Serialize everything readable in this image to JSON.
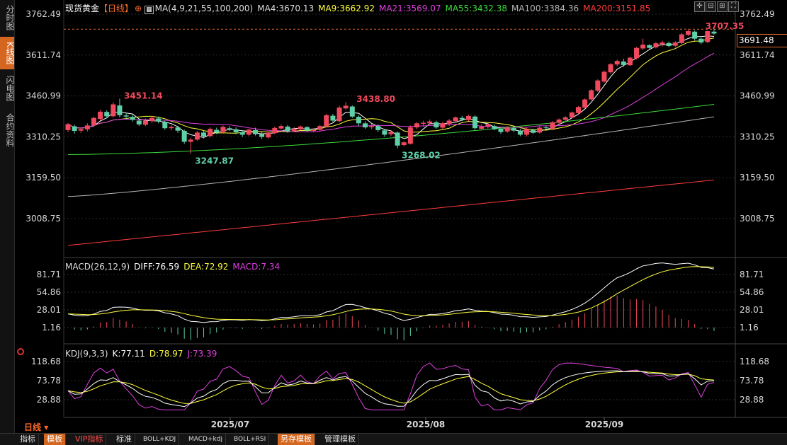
{
  "sidebar": {
    "tabs": [
      {
        "label": "分时图",
        "active": false
      },
      {
        "label": "K线图",
        "active": true
      },
      {
        "label": "闪电图",
        "active": false
      },
      {
        "label": "合约资料",
        "active": false
      }
    ]
  },
  "header": {
    "symbol": "现货黄金",
    "period_tag": "【日线】",
    "ma_params": "MA(4,9,21,55,100,200)",
    "ma4": "MA4:3670.13",
    "ma9": "MA9:3662.92",
    "ma21": "MA21:3569.07",
    "ma55": "MA55:3432.38",
    "ma100": "MA100:3384.36",
    "ma200": "MA200:3151.85"
  },
  "price_axis": {
    "labels": [
      "3762.49",
      "3611.74",
      "3460.99",
      "3310.25",
      "3159.50",
      "3008.75"
    ],
    "current_price": "3691.48"
  },
  "annotations": {
    "high1": "3451.14",
    "high2": "3438.80",
    "low1": "3247.87",
    "low2": "3268.02",
    "high_recent": "3707.35"
  },
  "macd": {
    "title": "MACD(26,12,9)",
    "diff": "DIFF:76.59",
    "dea": "DEA:72.92",
    "macd": "MACD:7.34",
    "axis_labels": [
      "81.71",
      "54.86",
      "28.01",
      "1.16"
    ]
  },
  "kdj": {
    "title": "KDJ(9,3,3)",
    "k": "K:77.11",
    "d": "D:78.97",
    "j": "J:73.39",
    "axis_labels": [
      "118.68",
      "73.78",
      "28.88"
    ]
  },
  "x_axis": {
    "labels": [
      "2025/07",
      "2025/08",
      "2025/09"
    ]
  },
  "period_label": "日线",
  "bottom_bar": {
    "buttons": [
      {
        "label": "指标",
        "style": "normal"
      },
      {
        "label": "模板",
        "style": "orange"
      },
      {
        "label": "VIP指标",
        "style": "red"
      },
      {
        "label": "标准",
        "style": "normal"
      },
      {
        "label": "BOLL+KDJ",
        "style": "small"
      },
      {
        "label": "MACD+kdj",
        "style": "small"
      },
      {
        "label": "BOLL+RSI",
        "style": "small"
      },
      {
        "label": "另存模板",
        "style": "orange"
      },
      {
        "label": "管理模板",
        "style": "normal"
      }
    ]
  },
  "colors": {
    "up": "#f0495d",
    "down": "#5ed0a8",
    "ma4": "#ffffff",
    "ma9": "#ffff3c",
    "ma21": "#e040e0",
    "ma55": "#3cdc3c",
    "ma100": "#b4b4b4",
    "ma200": "#ff3c3c",
    "accent": "#d4661f"
  },
  "chart_data": {
    "type": "candlestick",
    "price_axis_ticks": [
      3762.49,
      3611.74,
      3460.99,
      3310.25,
      3159.5,
      3008.75
    ],
    "candles": [
      [
        3335,
        3357,
        3328,
        3361
      ],
      [
        3349,
        3332,
        3322,
        3355
      ],
      [
        3333,
        3339,
        3324,
        3346
      ],
      [
        3338,
        3352,
        3330,
        3360
      ],
      [
        3352,
        3380,
        3347,
        3384
      ],
      [
        3376,
        3403,
        3370,
        3410
      ],
      [
        3402,
        3386,
        3378,
        3408
      ],
      [
        3386,
        3430,
        3382,
        3438
      ],
      [
        3426,
        3390,
        3382,
        3451
      ],
      [
        3389,
        3385,
        3375,
        3398
      ],
      [
        3384,
        3373,
        3366,
        3392
      ],
      [
        3370,
        3356,
        3350,
        3378
      ],
      [
        3355,
        3370,
        3350,
        3378
      ],
      [
        3368,
        3380,
        3362,
        3387
      ],
      [
        3378,
        3367,
        3360,
        3385
      ],
      [
        3365,
        3342,
        3336,
        3370
      ],
      [
        3342,
        3347,
        3334,
        3353
      ],
      [
        3345,
        3333,
        3325,
        3351
      ],
      [
        3332,
        3292,
        3284,
        3337
      ],
      [
        3292,
        3300,
        3248,
        3307
      ],
      [
        3300,
        3326,
        3296,
        3332
      ],
      [
        3326,
        3312,
        3304,
        3334
      ],
      [
        3313,
        3340,
        3308,
        3345
      ],
      [
        3336,
        3327,
        3320,
        3344
      ],
      [
        3328,
        3347,
        3322,
        3352
      ],
      [
        3342,
        3340,
        3332,
        3350
      ],
      [
        3338,
        3327,
        3320,
        3345
      ],
      [
        3327,
        3318,
        3310,
        3335
      ],
      [
        3318,
        3337,
        3313,
        3340
      ],
      [
        3335,
        3320,
        3315,
        3344
      ],
      [
        3320,
        3310,
        3302,
        3328
      ],
      [
        3308,
        3325,
        3304,
        3330
      ],
      [
        3324,
        3343,
        3320,
        3348
      ],
      [
        3341,
        3350,
        3337,
        3355
      ],
      [
        3348,
        3330,
        3325,
        3354
      ],
      [
        3332,
        3340,
        3328,
        3346
      ],
      [
        3338,
        3348,
        3334,
        3352
      ],
      [
        3346,
        3333,
        3328,
        3350
      ],
      [
        3332,
        3336,
        3328,
        3342
      ],
      [
        3336,
        3350,
        3330,
        3355
      ],
      [
        3348,
        3390,
        3345,
        3395
      ],
      [
        3388,
        3370,
        3365,
        3395
      ],
      [
        3368,
        3418,
        3364,
        3425
      ],
      [
        3415,
        3425,
        3410,
        3439
      ],
      [
        3422,
        3385,
        3380,
        3426
      ],
      [
        3384,
        3360,
        3350,
        3390
      ],
      [
        3360,
        3345,
        3340,
        3368
      ],
      [
        3346,
        3350,
        3338,
        3358
      ],
      [
        3350,
        3335,
        3328,
        3356
      ],
      [
        3334,
        3318,
        3310,
        3340
      ],
      [
        3320,
        3328,
        3314,
        3335
      ],
      [
        3326,
        3278,
        3268,
        3330
      ],
      [
        3280,
        3290,
        3275,
        3295
      ],
      [
        3285,
        3345,
        3282,
        3352
      ],
      [
        3345,
        3360,
        3338,
        3365
      ],
      [
        3358,
        3362,
        3348,
        3370
      ],
      [
        3360,
        3367,
        3355,
        3374
      ],
      [
        3364,
        3345,
        3340,
        3370
      ],
      [
        3344,
        3360,
        3338,
        3366
      ],
      [
        3358,
        3370,
        3350,
        3376
      ],
      [
        3368,
        3382,
        3362,
        3385
      ],
      [
        3380,
        3374,
        3368,
        3388
      ],
      [
        3372,
        3387,
        3368,
        3392
      ],
      [
        3385,
        3342,
        3336,
        3390
      ],
      [
        3340,
        3348,
        3334,
        3356
      ],
      [
        3348,
        3357,
        3341,
        3360
      ],
      [
        3350,
        3338,
        3334,
        3356
      ],
      [
        3340,
        3328,
        3320,
        3346
      ],
      [
        3330,
        3345,
        3325,
        3350
      ],
      [
        3343,
        3333,
        3328,
        3350
      ],
      [
        3332,
        3318,
        3313,
        3340
      ],
      [
        3318,
        3338,
        3312,
        3345
      ],
      [
        3336,
        3325,
        3320,
        3340
      ],
      [
        3326,
        3344,
        3322,
        3350
      ],
      [
        3345,
        3343,
        3338,
        3352
      ],
      [
        3340,
        3364,
        3336,
        3368
      ],
      [
        3362,
        3374,
        3356,
        3378
      ],
      [
        3373,
        3382,
        3369,
        3386
      ],
      [
        3381,
        3400,
        3378,
        3404
      ],
      [
        3398,
        3420,
        3394,
        3424
      ],
      [
        3418,
        3448,
        3415,
        3452
      ],
      [
        3448,
        3482,
        3444,
        3486
      ],
      [
        3480,
        3518,
        3476,
        3522
      ],
      [
        3514,
        3550,
        3510,
        3555
      ],
      [
        3548,
        3578,
        3542,
        3582
      ],
      [
        3577,
        3590,
        3570,
        3595
      ],
      [
        3588,
        3575,
        3568,
        3598
      ],
      [
        3574,
        3602,
        3572,
        3606
      ],
      [
        3600,
        3638,
        3596,
        3642
      ],
      [
        3636,
        3650,
        3630,
        3672
      ],
      [
        3648,
        3638,
        3632,
        3652
      ],
      [
        3640,
        3655,
        3636,
        3660
      ],
      [
        3652,
        3658,
        3643,
        3665
      ],
      [
        3656,
        3645,
        3640,
        3662
      ],
      [
        3646,
        3658,
        3640,
        3663
      ],
      [
        3656,
        3688,
        3653,
        3694
      ],
      [
        3686,
        3700,
        3682,
        3707
      ],
      [
        3698,
        3672,
        3665,
        3702
      ],
      [
        3672,
        3658,
        3652,
        3676
      ],
      [
        3660,
        3700,
        3655,
        3702
      ],
      [
        3698,
        3691,
        3686,
        3708
      ]
    ]
  }
}
